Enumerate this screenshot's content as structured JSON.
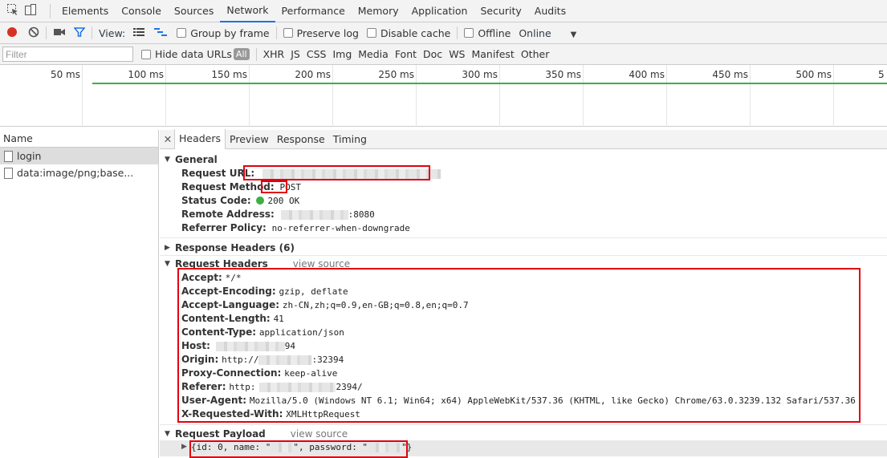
{
  "tabs": [
    "Elements",
    "Console",
    "Sources",
    "Network",
    "Performance",
    "Memory",
    "Application",
    "Security",
    "Audits"
  ],
  "active_tab": "Network",
  "toolbar": {
    "view_label": "View:",
    "group_by_frame": "Group by frame",
    "preserve_log": "Preserve log",
    "disable_cache": "Disable cache",
    "offline": "Offline",
    "throttle": "Online"
  },
  "filter": {
    "placeholder": "Filter",
    "hide_data_urls": "Hide data URLs",
    "types": [
      "All",
      "XHR",
      "JS",
      "CSS",
      "Img",
      "Media",
      "Font",
      "Doc",
      "WS",
      "Manifest",
      "Other"
    ]
  },
  "overview": {
    "ticks": [
      "50 ms",
      "100 ms",
      "150 ms",
      "200 ms",
      "250 ms",
      "300 ms",
      "350 ms",
      "400 ms",
      "450 ms",
      "500 ms",
      "5"
    ]
  },
  "requests": {
    "header": "Name",
    "items": [
      "login",
      "data:image/png;base..."
    ]
  },
  "detail_tabs": [
    "Headers",
    "Preview",
    "Response",
    "Timing"
  ],
  "general": {
    "title": "General",
    "request_url_label": "Request URL:",
    "request_method_label": "Request Method:",
    "request_method": "POST",
    "status_code_label": "Status Code:",
    "status_code": "200 OK",
    "remote_address_label": "Remote Address:",
    "remote_address_suffix": ":8080",
    "referrer_policy_label": "Referrer Policy:",
    "referrer_policy": "no-referrer-when-downgrade"
  },
  "response_headers": {
    "title": "Response Headers (6)"
  },
  "request_headers": {
    "title": "Request Headers",
    "view_source": "view source",
    "rows": [
      {
        "k": "Accept:",
        "v": "*/*"
      },
      {
        "k": "Accept-Encoding:",
        "v": "gzip, deflate"
      },
      {
        "k": "Accept-Language:",
        "v": "zh-CN,zh;q=0.9,en-GB;q=0.8,en;q=0.7"
      },
      {
        "k": "Content-Length:",
        "v": "41"
      },
      {
        "k": "Content-Type:",
        "v": "application/json"
      },
      {
        "k": "Host:",
        "v": "94"
      },
      {
        "k": "Origin:",
        "v": "http://",
        "v2": ":32394"
      },
      {
        "k": "Proxy-Connection:",
        "v": "keep-alive"
      },
      {
        "k": "Referer:",
        "v": "http:",
        "v2": "2394/"
      },
      {
        "k": "User-Agent:",
        "v": "Mozilla/5.0 (Windows NT 6.1; Win64; x64) AppleWebKit/537.36 (KHTML, like Gecko) Chrome/63.0.3239.132 Safari/537.36"
      },
      {
        "k": "X-Requested-With:",
        "v": "XMLHttpRequest"
      }
    ]
  },
  "payload": {
    "title": "Request Payload",
    "view_source": "view source",
    "part1": "{id: 0, name: \"",
    "part2": "\", password: \"",
    "part3": "\"}"
  },
  "colors": {
    "accent": "#1a73e8",
    "record": "#d93025",
    "highlight": "#e1000f",
    "success": "#3cb043"
  }
}
